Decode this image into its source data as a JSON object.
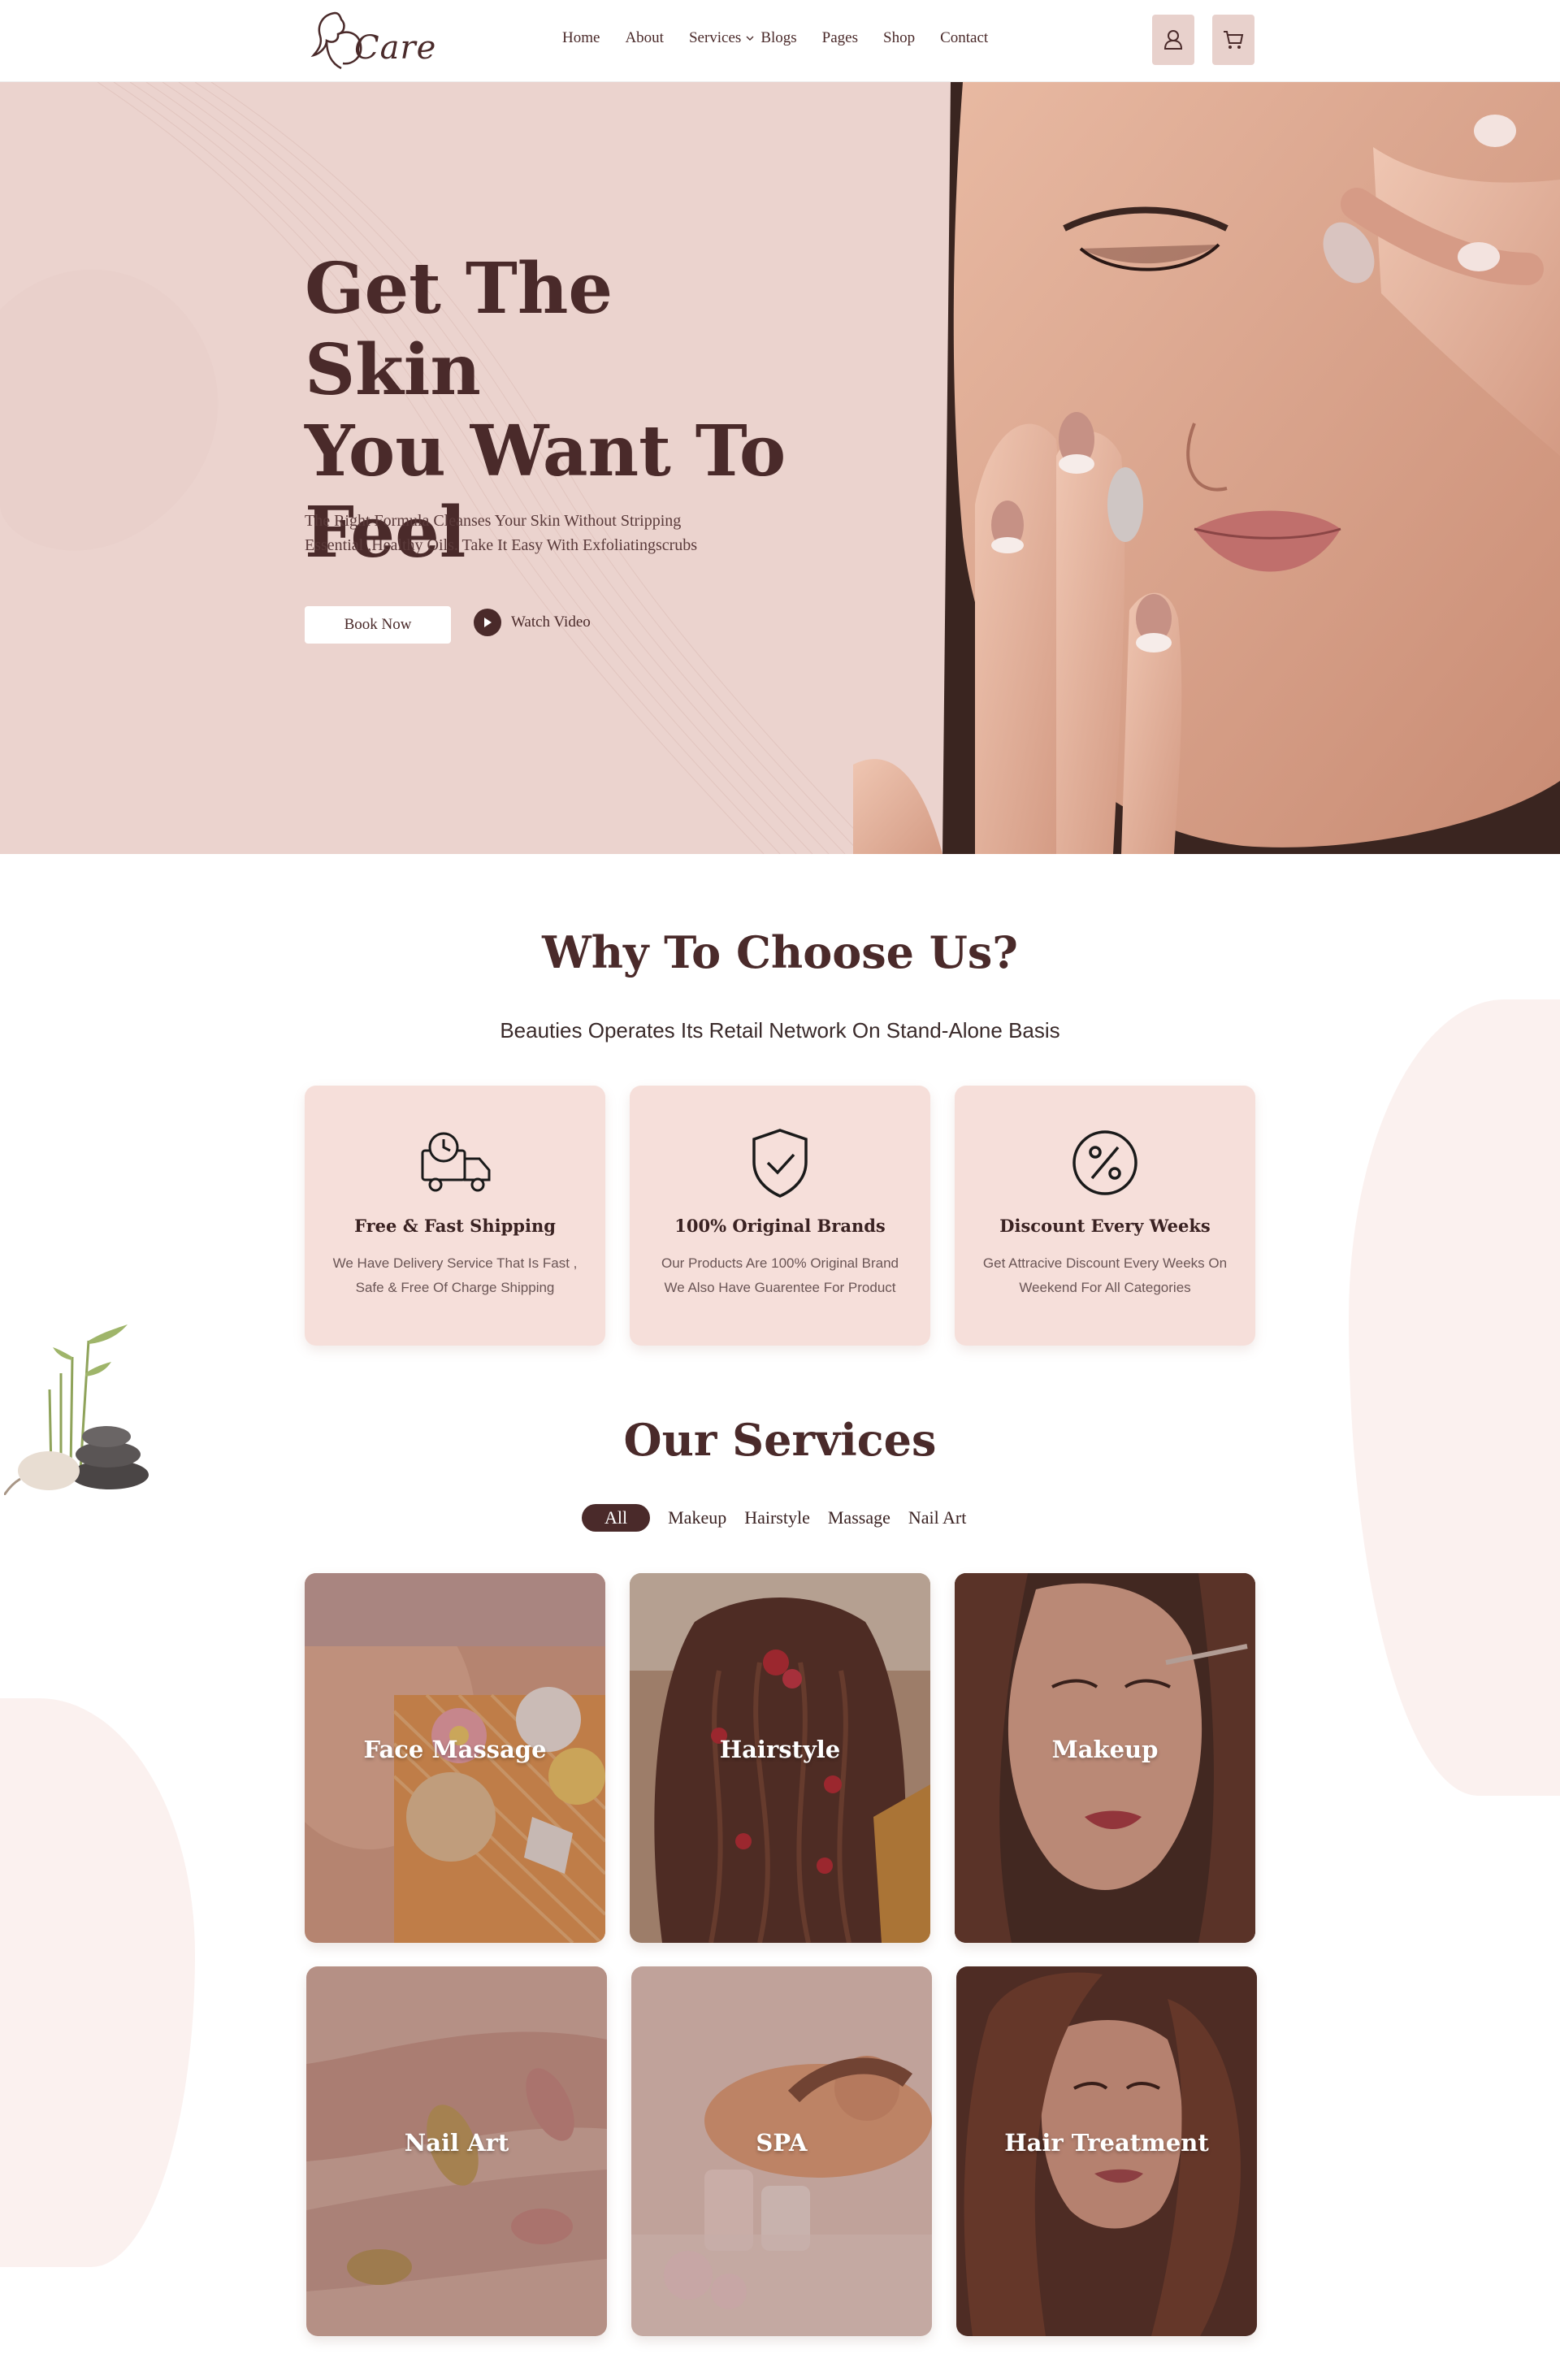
{
  "brand": {
    "logo_text": "Care"
  },
  "nav": {
    "items": [
      {
        "label": "Home"
      },
      {
        "label": "About"
      },
      {
        "label": "Services"
      },
      {
        "label": "Blogs"
      },
      {
        "label": "Pages"
      },
      {
        "label": "Shop"
      },
      {
        "label": "Contact"
      }
    ]
  },
  "hero": {
    "title_line1": "Get The Skin",
    "title_line2": "You Want To",
    "title_line3": "Feel",
    "subtitle": "The Right Formula Cleanses Your Skin Without Stripping Essential ,Healthy Oils. Take It Easy With Exfoliatingscrubs",
    "book_label": "Book Now",
    "video_label": "Watch Video"
  },
  "why": {
    "title": "Why To Choose Us?",
    "subtitle": "Beauties Operates Its Retail Network On Stand-Alone Basis",
    "features": [
      {
        "title": "Free & Fast Shipping",
        "text": "We Have  Delivery Service That Is Fast , Safe & Free Of Charge Shipping",
        "icon": "delivery-truck-icon"
      },
      {
        "title": "100% Original Brands",
        "text": "Our Products Are 100% Original Brand We Also Have Guarentee For Product",
        "icon": "shield-check-icon"
      },
      {
        "title": "Discount Every Weeks",
        "text": "Get Attracive Discount Every Weeks On Weekend For All Categories",
        "icon": "percent-icon"
      }
    ]
  },
  "services": {
    "title": "Our Services",
    "filters": [
      "All",
      "Makeup",
      "Hairstyle",
      "Massage",
      "Nail Art"
    ],
    "active_filter": "All",
    "cards": [
      {
        "label": "Face Massage"
      },
      {
        "label": "Hairstyle"
      },
      {
        "label": "Makeup"
      },
      {
        "label": "Nail Art"
      },
      {
        "label": "SPA"
      },
      {
        "label": "Hair Treatment"
      }
    ]
  },
  "colors": {
    "primary": "#4a2a2a",
    "hero_bg": "#ebd3ce",
    "card_bg": "#f6dfda",
    "icon_btn_bg": "#e8d1cc"
  }
}
